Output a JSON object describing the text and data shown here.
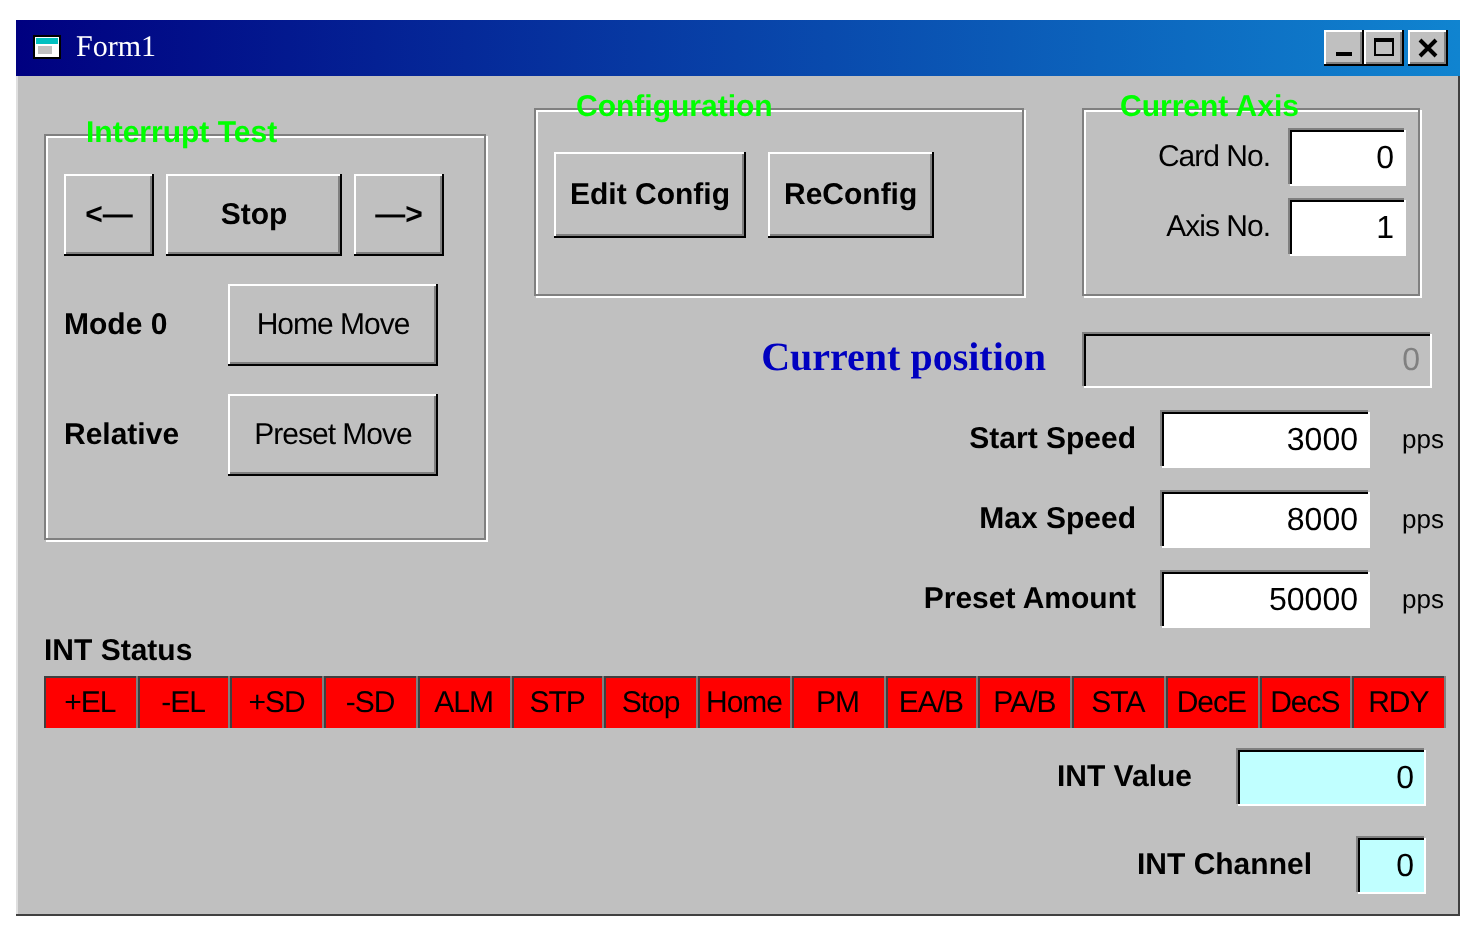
{
  "window": {
    "title": "Form1"
  },
  "interrupt_test": {
    "title": "Interrupt Test",
    "buttons": [
      "<—",
      "Stop",
      "—>"
    ],
    "rows": [
      {
        "label": "Mode 0",
        "button": "Home Move"
      },
      {
        "label": "Relative",
        "button": "Preset Move"
      }
    ]
  },
  "configuration": {
    "title": "Configuration",
    "buttons": [
      "Edit Config",
      "ReConfig"
    ]
  },
  "current_axis": {
    "title": "Current Axis",
    "fields": [
      {
        "label": "Card No.",
        "value": "0"
      },
      {
        "label": "Axis No.",
        "value": "1"
      }
    ]
  },
  "current_position": {
    "label": "Current position",
    "value": "0",
    "disabled": true
  },
  "motion": [
    {
      "label": "Start Speed",
      "value": "3000",
      "unit": "pps"
    },
    {
      "label": "Max Speed",
      "value": "8000",
      "unit": "pps"
    },
    {
      "label": "Preset Amount",
      "value": "50000",
      "unit": "pps"
    }
  ],
  "int_status": {
    "label": "INT Status",
    "flags": [
      {
        "label": "+EL"
      },
      {
        "label": "-EL"
      },
      {
        "label": "+SD"
      },
      {
        "label": "-SD"
      },
      {
        "label": "ALM"
      },
      {
        "label": "STP"
      },
      {
        "label": "Stop"
      },
      {
        "label": "Home"
      },
      {
        "label": "PM"
      },
      {
        "label": "EA/B"
      },
      {
        "label": "PA/B"
      },
      {
        "label": "STA"
      },
      {
        "label": "DecE"
      },
      {
        "label": "DecS"
      },
      {
        "label": "RDY"
      }
    ]
  },
  "int_value": {
    "label": "INT Value",
    "value": "0"
  },
  "int_channel": {
    "label": "INT Channel",
    "value": "0"
  }
}
